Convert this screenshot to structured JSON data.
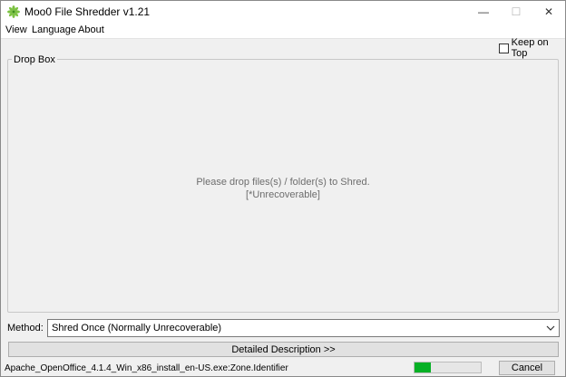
{
  "window": {
    "title": "Moo0 File Shredder v1.21",
    "minimize_glyph": "—",
    "maximize_glyph": "☐",
    "close_glyph": "✕",
    "app_icon": "leaf-icon"
  },
  "menu": {
    "items": [
      "View",
      "Language",
      "About"
    ]
  },
  "options": {
    "keep_on_top_label": "Keep on Top",
    "keep_on_top_checked": false
  },
  "dropbox": {
    "label": "Drop Box",
    "message_line1": "Please drop files(s) / folder(s) to Shred.",
    "message_line2": "[*Unrecoverable]"
  },
  "method": {
    "label": "Method:",
    "selected": "Shred Once (Normally Unrecoverable)"
  },
  "detailed_button_label": "Detailed Description >>",
  "status": {
    "current_file": "Apache_OpenOffice_4.1.4_Win_x86_install_en-US.exe:Zone.Identifier",
    "progress_fraction": 0.25,
    "progress_color": "#06b025",
    "cancel_label": "Cancel"
  }
}
